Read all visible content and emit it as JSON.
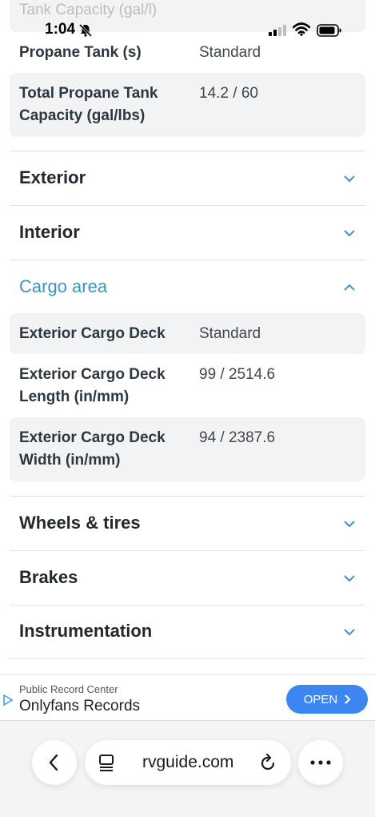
{
  "status_bar": {
    "time": "1:04"
  },
  "faded_header": "Tank Capacity (gal/l)",
  "specs_top": [
    {
      "label": "Propane Tank (s)",
      "value": "Standard"
    },
    {
      "label": "Total Propane Tank Capacity (gal/lbs)",
      "value": "14.2 / 60"
    }
  ],
  "sections": {
    "exterior": "Exterior",
    "interior": "Interior",
    "cargo_area": "Cargo area",
    "wheels_tires": "Wheels & tires",
    "brakes": "Brakes",
    "instrumentation": "Instrumentation"
  },
  "cargo_specs": [
    {
      "label": "Exterior Cargo Deck",
      "value": "Standard"
    },
    {
      "label": "Exterior Cargo Deck Length (in/mm)",
      "value": "99 / 2514.6"
    },
    {
      "label": "Exterior Cargo Deck Width (in/mm)",
      "value": "94 / 2387.6"
    }
  ],
  "ad": {
    "source": "Public Record Center",
    "title": "Onlyfans Records",
    "button_label": "OPEN"
  },
  "browser": {
    "url": "rvguide.com"
  },
  "colors": {
    "accent": "#3e93c3",
    "row_bg": "#f1f3f5",
    "ad_button": "#3b86f0"
  }
}
